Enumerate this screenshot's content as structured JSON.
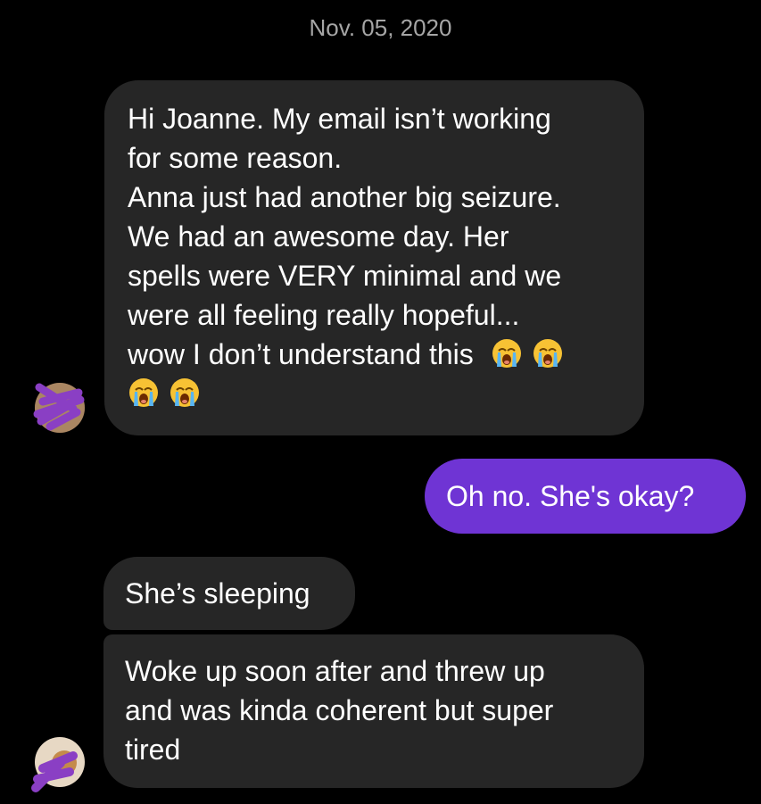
{
  "conversation": {
    "date_header": "Nov. 05, 2020",
    "messages": [
      {
        "sender": "contact",
        "lines": [
          "Hi Joanne. My email isn’t working",
          "for some reason.",
          "Anna just had another big seizure.",
          "We had an awesome day. Her",
          "spells were VERY minimal and we",
          "were all feeling really hopeful...",
          "wow I don’t understand this"
        ],
        "emoji": "loudly-crying-face",
        "emoji_count": 4
      },
      {
        "sender": "me",
        "lines": [
          "Oh no. She's okay?"
        ]
      },
      {
        "sender": "contact",
        "lines": [
          "She’s sleeping"
        ]
      },
      {
        "sender": "contact",
        "lines": [
          "Woke up soon after and threw up",
          "and was kinda coherent but super",
          "tired"
        ]
      }
    ]
  },
  "colors": {
    "background": "#000000",
    "incoming_bubble": "#262626",
    "outgoing_bubble": "#6f34d4",
    "date_text": "#a6a6a6",
    "avatar_scribble": "#8a3fc4"
  },
  "icons": {
    "avatar": "contact-avatar-redacted",
    "emoji": "loudly-crying-face"
  }
}
